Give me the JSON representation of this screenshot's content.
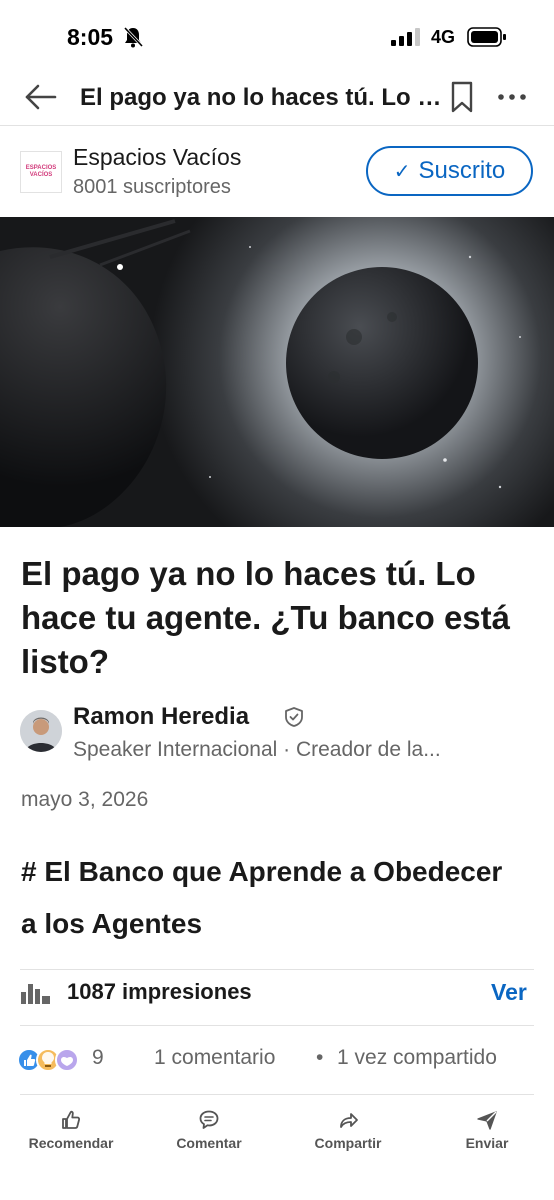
{
  "status": {
    "time": "8:05",
    "network": "4G"
  },
  "header": {
    "title": "El pago ya no lo haces tú. Lo hace tu agente. ¿Tu banco está listo?"
  },
  "newsletter": {
    "logo_text": "ESPACIOS VACÍOS",
    "name": "Espacios Vacíos",
    "subscribers": "8001 suscriptores",
    "subscribe_label": "Suscrito"
  },
  "article": {
    "title": "El pago ya no lo haces tú. Lo hace tu agente. ¿Tu banco está listo?",
    "author_name": "Ramon Heredia",
    "author_description": "Speaker Internacional · Creador de la...",
    "date": "mayo 3, 2026",
    "section_heading": "# El Banco que Aprende a Obedecer a los Agentes"
  },
  "stats": {
    "impressions": "1087 impresiones",
    "view_label": "Ver",
    "reaction_count": "9",
    "comments": "1 comentario",
    "separator": "•",
    "shares": "1 vez compartido"
  },
  "actions": [
    {
      "label": "Recomendar",
      "icon": "thumbs-up-icon"
    },
    {
      "label": "Comentar",
      "icon": "comment-icon"
    },
    {
      "label": "Compartir",
      "icon": "share-icon"
    },
    {
      "label": "Enviar",
      "icon": "send-icon"
    }
  ],
  "colors": {
    "accent": "#0a66c2",
    "text": "#1a1a1a",
    "secondary_text": "#666666"
  }
}
